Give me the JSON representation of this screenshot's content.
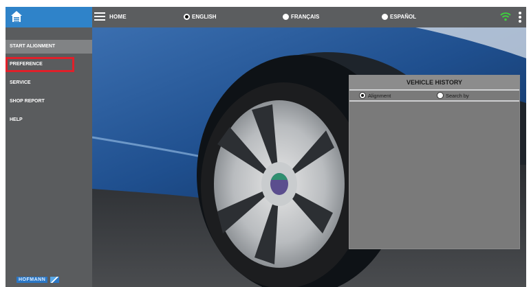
{
  "topbar": {
    "home_label": "HOME",
    "languages": [
      {
        "label": "ENGLISH",
        "selected": true
      },
      {
        "label": "FRANÇAIS",
        "selected": false
      },
      {
        "label": "ESPAÑOL",
        "selected": false
      }
    ],
    "logo_icon": "app-home-icon",
    "wifi_icon": "wifi-icon",
    "menu_icon": "more-vert-icon"
  },
  "sidebar": {
    "items": [
      {
        "label": "START ALIGNMENT",
        "active": true
      },
      {
        "label": "PREFERENCE",
        "active": false
      },
      {
        "label": "SERVICE",
        "active": false
      },
      {
        "label": "SHOP REPORT",
        "active": false
      },
      {
        "label": "HELP",
        "active": false
      }
    ],
    "brand": "HOFMANN"
  },
  "history": {
    "title": "VEHICLE HISTORY",
    "options": [
      {
        "label": "Alignment",
        "selected": true
      },
      {
        "label": "Search by",
        "selected": false
      }
    ]
  },
  "colors": {
    "accent": "#2f83c9",
    "topbar": "#5b5d5f",
    "sidebar": "#5a5c5e",
    "sidebar_active": "#818385",
    "highlight": "#e0202a",
    "panel": "#7a7a7a",
    "wifi": "#3fcf3f"
  }
}
